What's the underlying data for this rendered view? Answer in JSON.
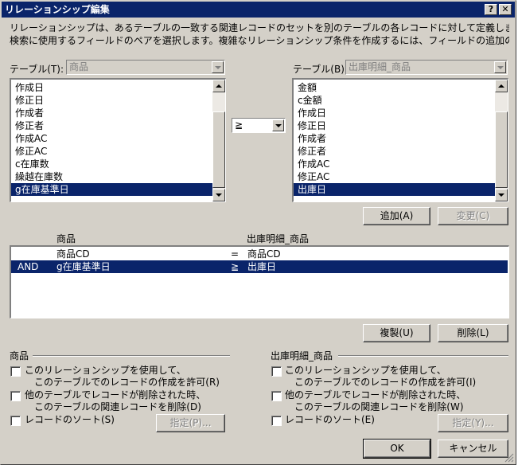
{
  "window": {
    "title": "リレーションシップ編集",
    "help_btn": "?",
    "close_btn": "✕"
  },
  "description": {
    "line1": "リレーションシップは、あるテーブルの一致する関連レコードのセットを別のテーブルの各レコードに対して定義します。一致するレコードの",
    "line2": "検索に使用するフィールドのペアを選択します。複雑なリレーションシップ条件を作成するには、フィールドの追加のペアを使用します。"
  },
  "left_table": {
    "label": "テーブル(T):",
    "value": "商品",
    "fields": [
      "作成日",
      "修正日",
      "作成者",
      "修正者",
      "作成AC",
      "修正AC",
      "c在庫数",
      "繰越在庫数",
      "g在庫基準日"
    ],
    "selected_index": 8
  },
  "operator": {
    "value": "≧"
  },
  "right_table": {
    "label": "テーブル(B):",
    "value": "出庫明細_商品",
    "fields": [
      "金額",
      "c金額",
      "作成日",
      "修正日",
      "作成者",
      "修正者",
      "作成AC",
      "修正AC",
      "出庫日"
    ],
    "selected_index": 8
  },
  "buttons": {
    "add": "追加(A)",
    "change": "変更(C)",
    "duplicate": "複製(U)",
    "delete": "削除(L)",
    "spec_left": "指定(P)...",
    "spec_right": "指定(Y)...",
    "ok": "OK",
    "cancel": "キャンセル"
  },
  "pairs": {
    "header_left": "商品",
    "header_right": "出庫明細_商品",
    "rows": [
      {
        "logic": "",
        "left": "商品CD",
        "op": "=",
        "right": "商品CD",
        "selected": false
      },
      {
        "logic": "AND",
        "left": "g在庫基準日",
        "op": "≧",
        "right": "出庫日",
        "selected": true
      }
    ]
  },
  "left_options": {
    "group_title": "商品",
    "opt1_line1": "このリレーションシップを使用して、",
    "opt1_line2": "このテーブルでのレコードの作成を許可(R)",
    "opt2_line1": "他のテーブルでレコードが削除された時、",
    "opt2_line2": "このテーブルの関連レコードを削除(D)",
    "opt3": "レコードのソート(S)"
  },
  "right_options": {
    "group_title": "出庫明細_商品",
    "opt1_line1": "このリレーションシップを使用して、",
    "opt1_line2": "このテーブルでのレコードの作成を許可(I)",
    "opt2_line1": "他のテーブルでレコードが削除された時、",
    "opt2_line2": "このテーブルの関連レコードを削除(W)",
    "opt3": "レコードのソート(E)"
  }
}
